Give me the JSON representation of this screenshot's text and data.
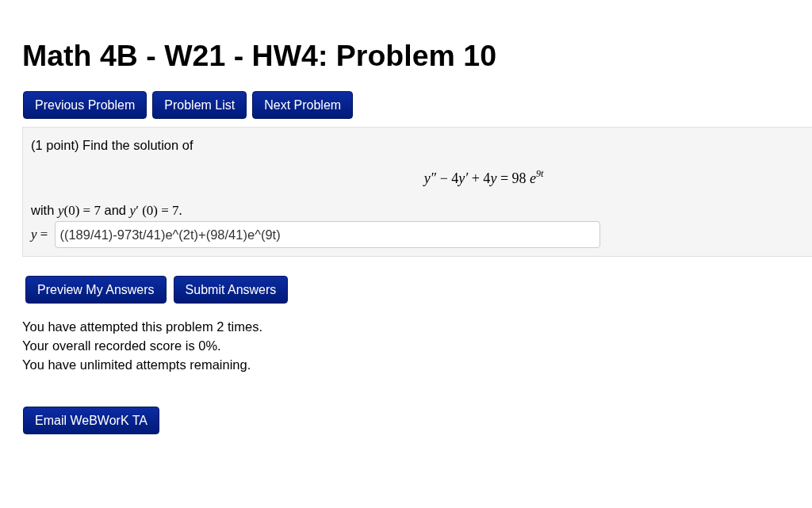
{
  "title": "Math 4B - W21 - HW4: Problem 10",
  "nav_buttons": [
    {
      "label": "Previous Problem"
    },
    {
      "label": "Problem List"
    },
    {
      "label": "Next Problem"
    }
  ],
  "problem": {
    "intro": "(1 point) Find the solution of",
    "equation": [
      {
        "kind": "var",
        "text": "y″"
      },
      {
        "kind": "num",
        "text": " − 4"
      },
      {
        "kind": "var",
        "text": "y′"
      },
      {
        "kind": "num",
        "text": " + 4"
      },
      {
        "kind": "var",
        "text": "y"
      },
      {
        "kind": "num",
        "text": " = 98 "
      },
      {
        "kind": "var",
        "text": "e"
      },
      {
        "kind": "sup",
        "text": "9t"
      }
    ],
    "conditions": [
      {
        "kind": "text",
        "text": "with "
      },
      {
        "kind": "math",
        "text": "*y*(0) = 7"
      },
      {
        "kind": "text",
        "text": " and "
      },
      {
        "kind": "math",
        "text": "*y*′ (0) = 7."
      }
    ],
    "answer_label": "*y* =",
    "answer_value": "((189/41)-973t/41)e^(2t)+(98/41)e^(9t)"
  },
  "action_buttons": [
    {
      "label": "Preview My Answers"
    },
    {
      "label": "Submit Answers"
    }
  ],
  "messages": [
    "You have attempted this problem 2 times.",
    "Your overall recorded score is 0%.",
    "You have unlimited attempts remaining."
  ],
  "footer_button": {
    "label": "Email WeBWorK TA"
  }
}
